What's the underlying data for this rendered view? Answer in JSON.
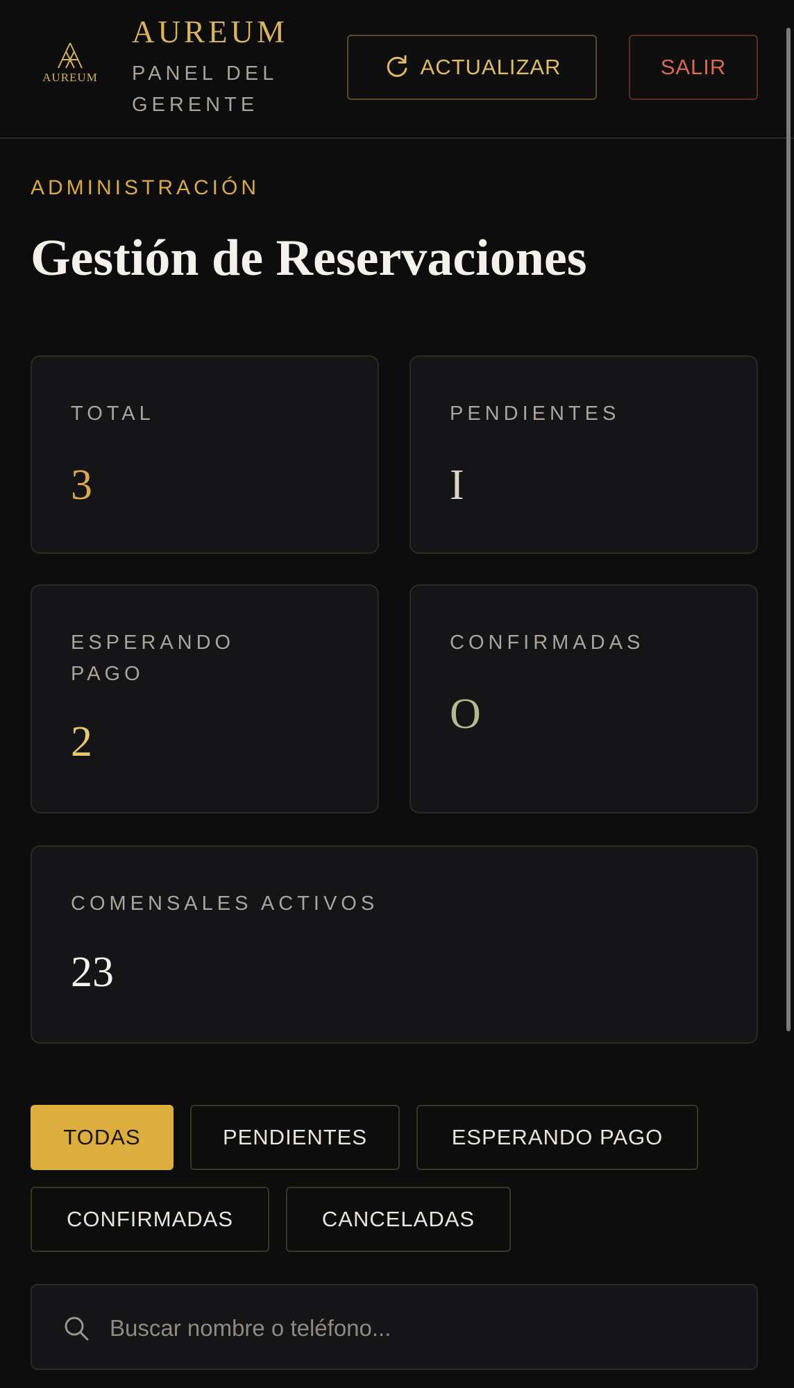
{
  "header": {
    "logo_text": "AUREUM",
    "brand_name": "AUREUM",
    "brand_subtitle": "PANEL DEL GERENTE",
    "refresh_label": "ACTUALIZAR",
    "logout_label": "SALIR"
  },
  "main": {
    "eyebrow": "ADMINISTRACIÓN",
    "title": "Gestión de Reservaciones"
  },
  "stats": [
    {
      "label": "TOTAL",
      "value": "3",
      "color": "#d9a94a"
    },
    {
      "label": "PENDIENTES",
      "value": "I",
      "color": "#d9d4c6"
    },
    {
      "label": "ESPERANDO PAGO",
      "value": "2",
      "color": "#ecc66a"
    },
    {
      "label": "CONFIRMADAS",
      "value": "O",
      "color": "#b6b98e"
    },
    {
      "label": "COMENSALES ACTIVOS",
      "value": "23",
      "color": "#f4f1ea"
    }
  ],
  "filters": [
    {
      "label": "TODAS",
      "active": true
    },
    {
      "label": "PENDIENTES",
      "active": false
    },
    {
      "label": "ESPERANDO PAGO",
      "active": false
    },
    {
      "label": "CONFIRMADAS",
      "active": false
    },
    {
      "label": "CANCELADAS",
      "active": false
    }
  ],
  "search": {
    "placeholder": "Buscar nombre o teléfono...",
    "value": "",
    "icon": "search-icon"
  },
  "colors": {
    "accent": "#dcae3e",
    "danger": "#d96a52",
    "background": "#0d0d0d",
    "card": "#151517"
  }
}
